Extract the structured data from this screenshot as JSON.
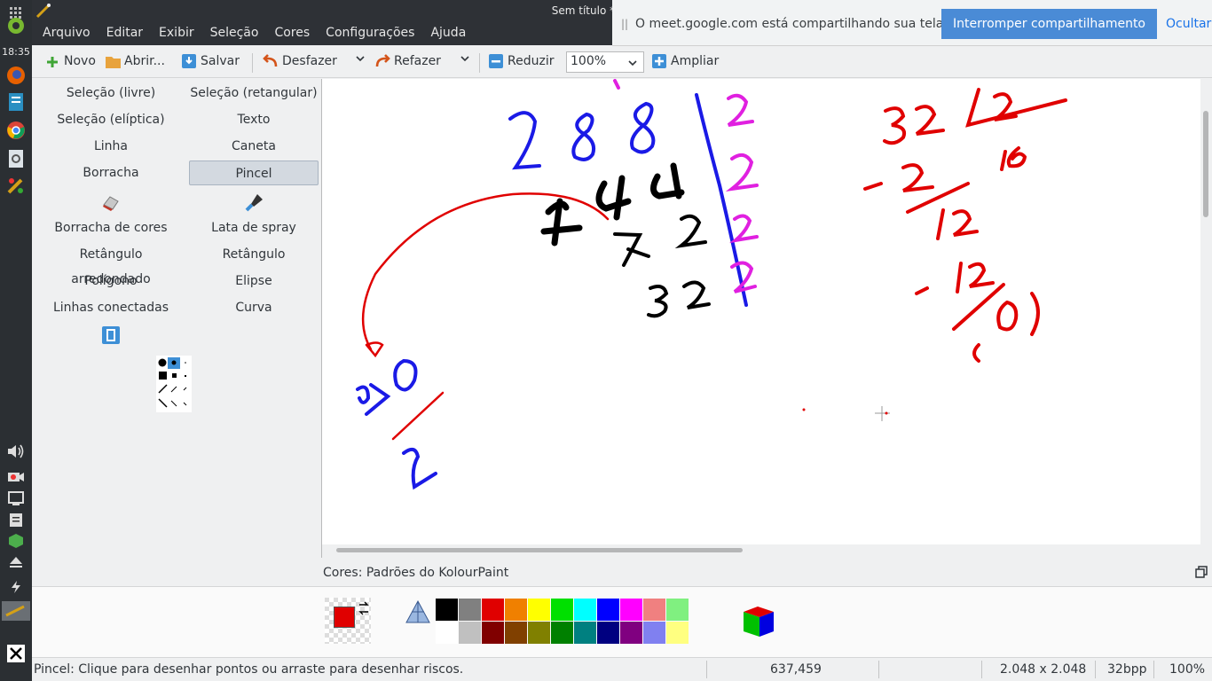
{
  "window": {
    "title": "Sem título * — KolourPaint"
  },
  "system_panel": {
    "clock": "18:35"
  },
  "menu": [
    "Arquivo",
    "Editar",
    "Exibir",
    "Seleção",
    "Cores",
    "Configurações",
    "Ajuda"
  ],
  "share_banner": {
    "grip": "||",
    "text": "O meet.google.com está compartilhando sua tela.",
    "stop_label": "Interromper compartilhamento",
    "hide_label": "Ocultar"
  },
  "toolbar": {
    "new": "Novo",
    "open": "Abrir...",
    "save": "Salvar",
    "undo": "Desfazer",
    "redo": "Refazer",
    "zoom_out": "Reduzir",
    "zoom_value": "100%",
    "zoom_in": "Ampliar"
  },
  "tools": [
    "Seleção (livre)",
    "Seleção (retangular)",
    "Seleção (elíptica)",
    "Texto",
    "Linha",
    "Caneta",
    "Borracha",
    "Pincel",
    "Borracha de cores",
    "Lata de spray",
    "Retângulo arredondado",
    "Retângulo",
    "Polígono",
    "Elipse",
    "Linhas conectadas",
    "Curva"
  ],
  "selected_tool": "Pincel",
  "colors_panel": {
    "title": "Cores: Padrões do KolourPaint",
    "foreground": "#e00000",
    "palette_top": [
      "#000000",
      "#808080",
      "#e00000",
      "#f08000",
      "#ffff00",
      "#00e000",
      "#00ffff",
      "#0000ff",
      "#ff00ff",
      "#f08080",
      "#80f080"
    ],
    "palette_bottom": [
      "#ffffff",
      "#c0c0c0",
      "#800000",
      "#804000",
      "#808000",
      "#008000",
      "#008080",
      "#000080",
      "#800080",
      "#8080f0",
      "#ffff80"
    ]
  },
  "status": {
    "message": "Pincel: Clique para desenhar pontos ou arraste para desenhar riscos.",
    "coords": "637,459",
    "size": "2.048 x 2.048",
    "depth": "32bpp",
    "zoom": "100%"
  }
}
